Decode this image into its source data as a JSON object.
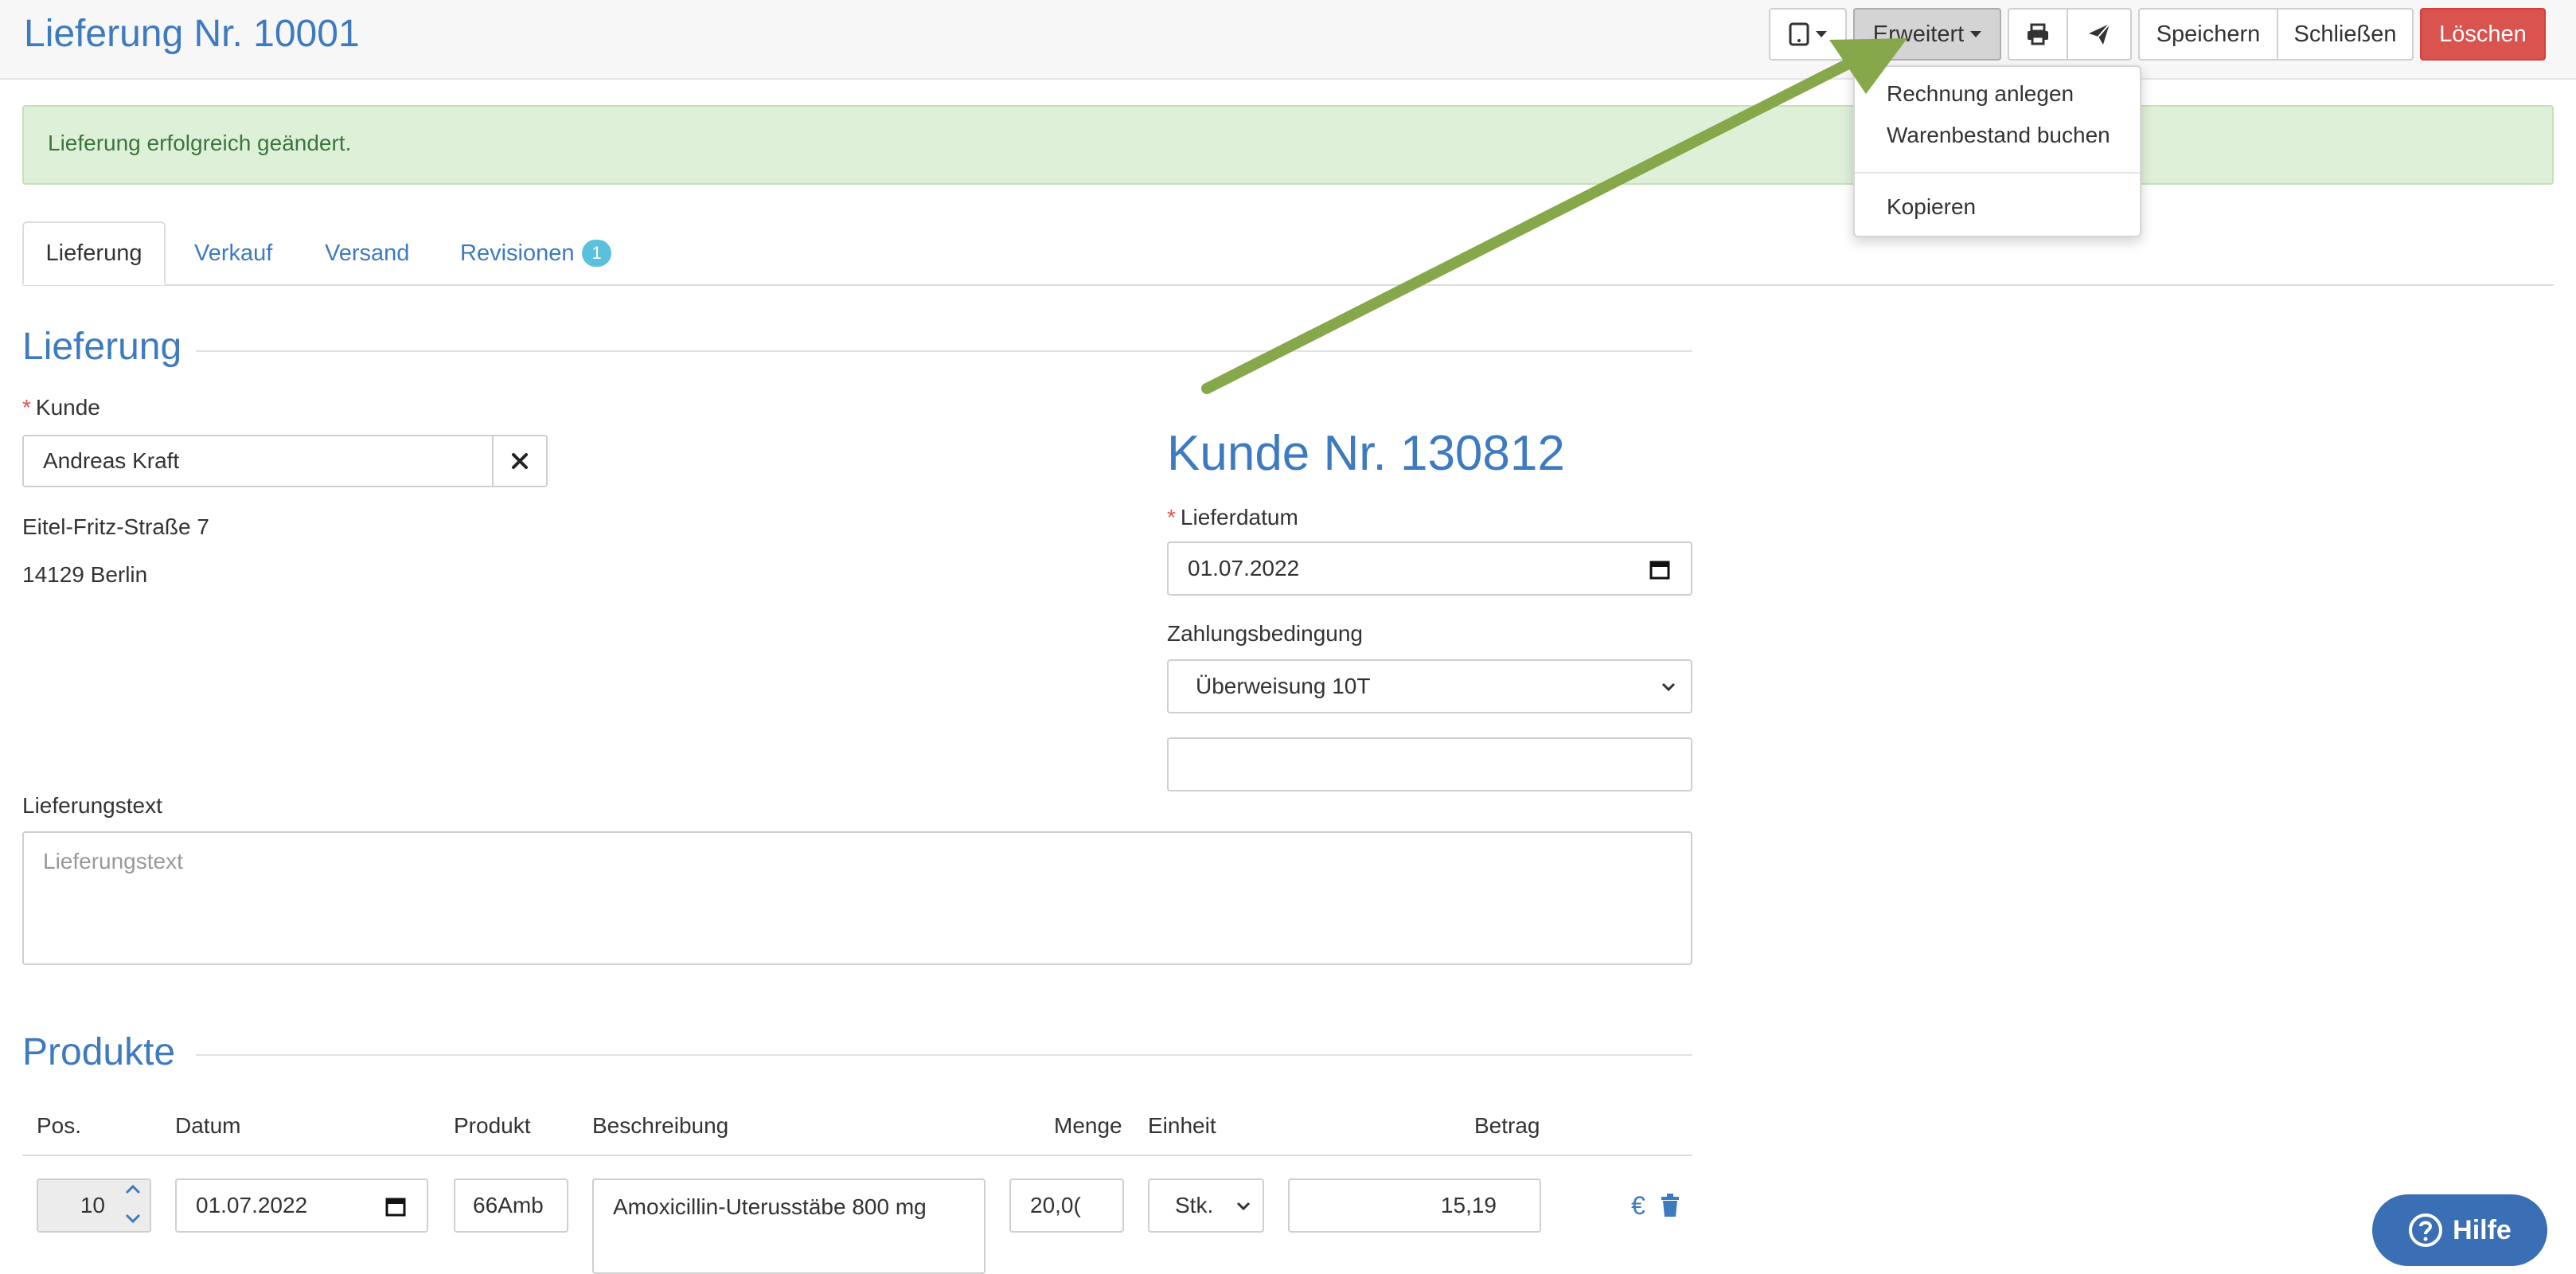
{
  "header": {
    "title": "Lieferung Nr. 10001",
    "buttons": {
      "erweitert": "Erweitert",
      "speichern": "Speichern",
      "schliessen": "Schließen",
      "loeschen": "Löschen"
    },
    "icons": [
      "tablet-icon",
      "print-icon",
      "send-icon"
    ]
  },
  "dropdown": {
    "items": [
      "Rechnung anlegen",
      "Warenbestand buchen",
      "Kopieren"
    ]
  },
  "alert": {
    "text": "Lieferung erfolgreich geändert."
  },
  "tabs": [
    {
      "label": "Lieferung",
      "active": true
    },
    {
      "label": "Verkauf"
    },
    {
      "label": "Versand"
    },
    {
      "label": "Revisionen",
      "badge": "1"
    }
  ],
  "lieferung": {
    "section_title": "Lieferung",
    "kunde_label": "Kunde",
    "required_mark": "*",
    "kunde_value": "Andreas Kraft",
    "address_line1": "Eitel-Fritz-Straße 7",
    "address_line2": "14129 Berlin",
    "kunde_heading": "Kunde Nr. 130812",
    "lieferdatum_label": "Lieferdatum",
    "lieferdatum_value": "01.07.2022",
    "zahlung_label": "Zahlungsbedingung",
    "zahlung_value": "Überweisung 10T",
    "text_label": "Lieferungstext",
    "text_placeholder": "Lieferungstext"
  },
  "produkte": {
    "section_title": "Produkte",
    "columns": [
      "Pos.",
      "Datum",
      "Produkt",
      "Beschreibung",
      "Menge",
      "Einheit",
      "Betrag"
    ],
    "rows": [
      {
        "pos": "10",
        "datum": "01.07.2022",
        "produkt": "66Amb",
        "beschreibung": "Amoxicillin-Uterusstäbe 800 mg",
        "menge": "20,0(",
        "einheit": "Stk.",
        "betrag": "15,19"
      }
    ]
  },
  "help": {
    "label": "Hilfe"
  },
  "colors": {
    "accent": "#3d7ac0",
    "danger": "#d9534f",
    "success_bg": "#dff0d8",
    "arrow": "#86a84a"
  }
}
